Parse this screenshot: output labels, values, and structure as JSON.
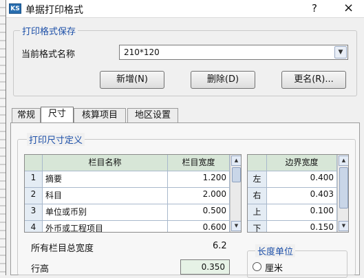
{
  "window": {
    "icon_text": "KS",
    "title": "单据打印格式",
    "help": "?",
    "close": "×"
  },
  "save_group": {
    "legend": "打印格式保存",
    "name_label": "当前格式名称",
    "name_value": "210*120",
    "buttons": {
      "new": "新增(N)",
      "delete": "删除(D)",
      "rename": "更名(R)..."
    }
  },
  "tabs": [
    "常规",
    "尺寸",
    "核算项目",
    "地区设置"
  ],
  "active_tab": 1,
  "size_group": {
    "legend": "打印尺寸定义",
    "columns_table": {
      "headers": [
        "栏目名称",
        "栏目宽度"
      ],
      "rows": [
        {
          "no": "1",
          "name": "摘要",
          "width": "1.200"
        },
        {
          "no": "2",
          "name": "科目",
          "width": "2.000"
        },
        {
          "no": "3",
          "name": "单位或币别",
          "width": "0.500"
        },
        {
          "no": "4",
          "name": "外币或工程项目",
          "width": "0.600"
        }
      ]
    },
    "margin_table": {
      "header": "边界宽度",
      "rows": [
        {
          "side": "左",
          "value": "0.400"
        },
        {
          "side": "右",
          "value": "0.403"
        },
        {
          "side": "上",
          "value": "0.100"
        },
        {
          "side": "下",
          "value": "0.150"
        }
      ]
    },
    "total_label": "所有栏目总宽度",
    "total_value": "6.2",
    "row_height_label": "行高",
    "row_height_value": "0.350",
    "unit_group": {
      "legend": "长度单位",
      "options": [
        "厘米"
      ]
    }
  }
}
